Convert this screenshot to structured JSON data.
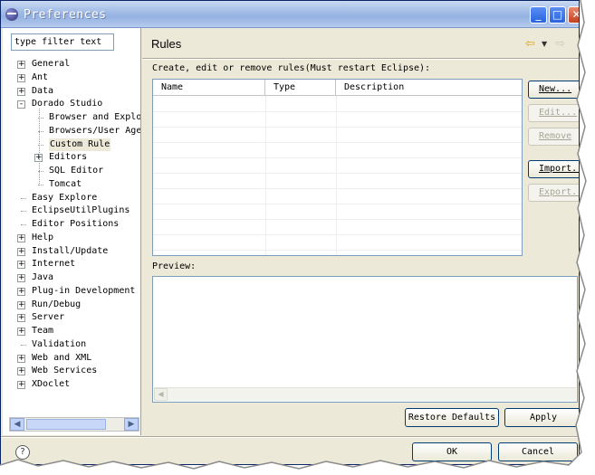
{
  "window": {
    "title": "Preferences"
  },
  "left": {
    "filter_value": "type filter text",
    "tree": [
      {
        "label": "General",
        "depth": 0,
        "toggle": "+"
      },
      {
        "label": "Ant",
        "depth": 0,
        "toggle": "+"
      },
      {
        "label": "Data",
        "depth": 0,
        "toggle": "+"
      },
      {
        "label": "Dorado Studio",
        "depth": 0,
        "toggle": "-"
      },
      {
        "label": "Browser and Explo",
        "depth": 1,
        "toggle": ""
      },
      {
        "label": "Browsers/User Age",
        "depth": 1,
        "toggle": ""
      },
      {
        "label": "Custom Rule",
        "depth": 1,
        "toggle": "",
        "selected": true
      },
      {
        "label": "Editors",
        "depth": 1,
        "toggle": "+"
      },
      {
        "label": "SQL Editor",
        "depth": 1,
        "toggle": ""
      },
      {
        "label": "Tomcat",
        "depth": 1,
        "toggle": ""
      },
      {
        "label": "Easy Explore",
        "depth": 0,
        "toggle": ""
      },
      {
        "label": "EclipseUtilPlugins",
        "depth": 0,
        "toggle": ""
      },
      {
        "label": "Editor Positions",
        "depth": 0,
        "toggle": ""
      },
      {
        "label": "Help",
        "depth": 0,
        "toggle": "+"
      },
      {
        "label": "Install/Update",
        "depth": 0,
        "toggle": "+"
      },
      {
        "label": "Internet",
        "depth": 0,
        "toggle": "+"
      },
      {
        "label": "Java",
        "depth": 0,
        "toggle": "+"
      },
      {
        "label": "Plug-in Development",
        "depth": 0,
        "toggle": "+"
      },
      {
        "label": "Run/Debug",
        "depth": 0,
        "toggle": "+"
      },
      {
        "label": "Server",
        "depth": 0,
        "toggle": "+"
      },
      {
        "label": "Team",
        "depth": 0,
        "toggle": "+"
      },
      {
        "label": "Validation",
        "depth": 0,
        "toggle": ""
      },
      {
        "label": "Web and XML",
        "depth": 0,
        "toggle": "+"
      },
      {
        "label": "Web Services",
        "depth": 0,
        "toggle": "+"
      },
      {
        "label": "XDoclet",
        "depth": 0,
        "toggle": "+"
      }
    ]
  },
  "page": {
    "title": "Rules",
    "description": "Create, edit or remove rules(Must restart Eclipse):",
    "columns": [
      "Name",
      "Type",
      "Description"
    ],
    "buttons": {
      "new": "New...",
      "edit": "Edit...",
      "remove": "Remove",
      "import": "Import...",
      "export": "Export..."
    },
    "preview_label": "Preview:",
    "restore_defaults": "Restore Defaults",
    "apply": "Apply"
  },
  "footer": {
    "ok": "OK",
    "cancel": "Cancel"
  },
  "icons": [
    "app-icon",
    "back-arrow-icon",
    "dropdown-icon",
    "forward-arrow-icon",
    "help-icon",
    "minimize-icon",
    "maximize-icon",
    "close-icon"
  ]
}
